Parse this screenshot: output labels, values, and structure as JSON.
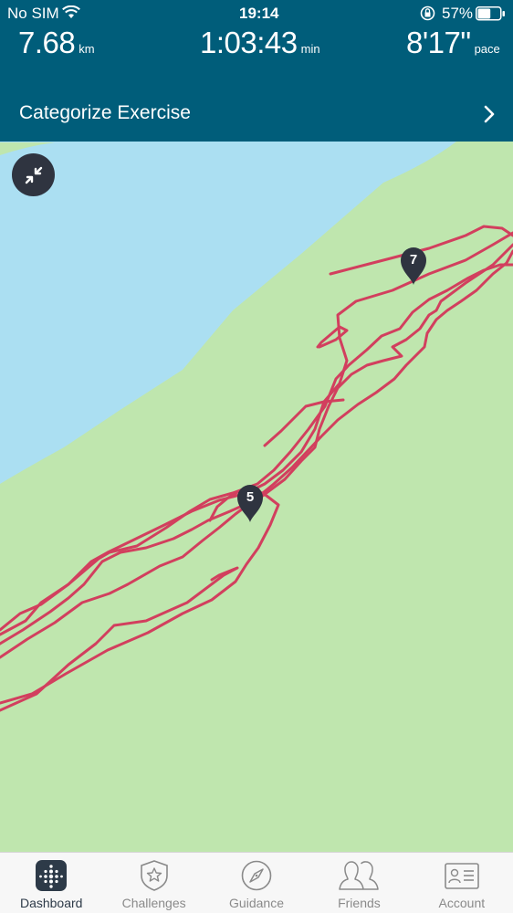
{
  "status_bar": {
    "carrier": "No SIM",
    "time": "19:14",
    "battery_percent": "57%",
    "battery_level": 0.57
  },
  "summary": {
    "distance": {
      "value": "7.68",
      "unit": "km"
    },
    "duration": {
      "value": "1:03:43",
      "unit": "min"
    },
    "pace": {
      "value": "8'17\"",
      "unit": "pace"
    }
  },
  "categorize": {
    "label": "Categorize Exercise"
  },
  "map": {
    "markers": [
      {
        "label": "5"
      },
      {
        "label": "7"
      }
    ]
  },
  "tabs": [
    {
      "label": "Dashboard",
      "icon": "dashboard-icon",
      "active": true
    },
    {
      "label": "Challenges",
      "icon": "challenges-icon",
      "active": false
    },
    {
      "label": "Guidance",
      "icon": "guidance-icon",
      "active": false
    },
    {
      "label": "Friends",
      "icon": "friends-icon",
      "active": false
    },
    {
      "label": "Account",
      "icon": "account-icon",
      "active": false
    }
  ],
  "colors": {
    "header": "#005d7a",
    "water": "#abdff2",
    "land": "#bfe6ae",
    "route": "#d23f5e",
    "pin": "#2f3440"
  }
}
